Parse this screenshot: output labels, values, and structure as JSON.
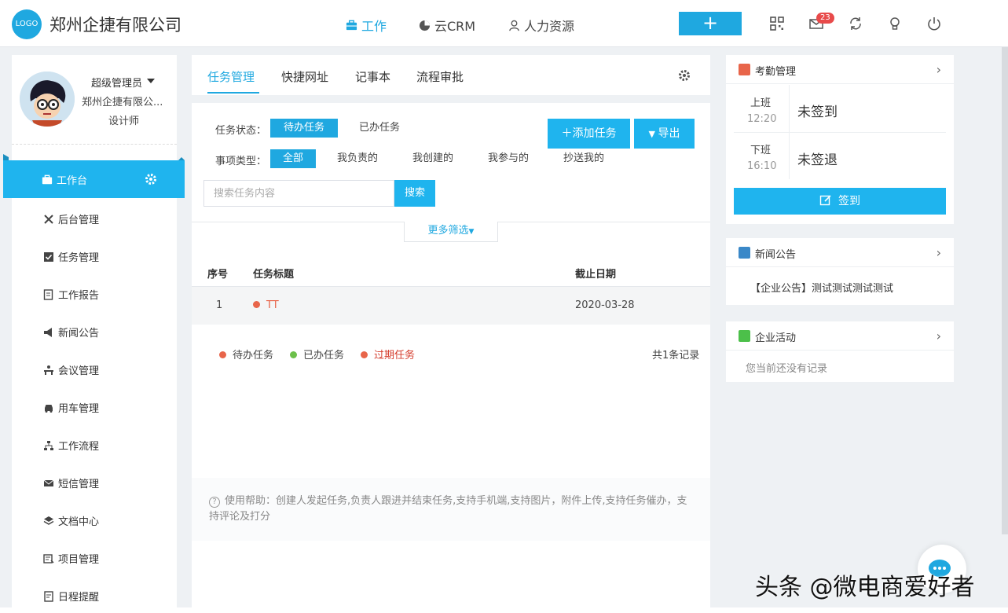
{
  "header": {
    "logo_text": "LOGO",
    "company": "郑州企捷有限公司",
    "nav": [
      {
        "label": "工作",
        "icon": "briefcase-icon",
        "active": true
      },
      {
        "label": "云CRM",
        "icon": "pie-chart-icon",
        "active": false
      },
      {
        "label": "人力资源",
        "icon": "user-icon",
        "active": false
      }
    ],
    "add_label": "+",
    "message_count": "23",
    "accent": "#1fa8e0"
  },
  "sidebar": {
    "role": "超级管理员",
    "company": "郑州企捷有限公...",
    "title": "设计师",
    "items": [
      {
        "label": "工作台",
        "icon": "briefcase-icon"
      },
      {
        "label": "后台管理",
        "icon": "tools-icon"
      },
      {
        "label": "任务管理",
        "icon": "checkbox-icon"
      },
      {
        "label": "工作报告",
        "icon": "report-icon"
      },
      {
        "label": "新闻公告",
        "icon": "megaphone-icon"
      },
      {
        "label": "会议管理",
        "icon": "meeting-icon"
      },
      {
        "label": "用车管理",
        "icon": "car-icon"
      },
      {
        "label": "工作流程",
        "icon": "flow-icon"
      },
      {
        "label": "短信管理",
        "icon": "mail-icon"
      },
      {
        "label": "文档中心",
        "icon": "layers-icon"
      },
      {
        "label": "项目管理",
        "icon": "project-icon"
      },
      {
        "label": "日程提醒",
        "icon": "calendar-icon"
      }
    ]
  },
  "main": {
    "tabs": [
      "任务管理",
      "快捷网址",
      "记事本",
      "流程审批"
    ],
    "status_label": "任务状态：",
    "status_options": [
      "待办任务",
      "已办任务"
    ],
    "type_label": "事项类型：",
    "type_options": [
      "全部",
      "我负责的",
      "我创建的",
      "我参与的",
      "抄送我的"
    ],
    "add_task": "添加任务",
    "export": "导出",
    "search_placeholder": "搜索任务内容",
    "search_btn": "搜索",
    "more_filter": "更多筛选",
    "columns": [
      "序号",
      "任务标题",
      "截止日期"
    ],
    "rows": [
      {
        "no": "1",
        "title": "TT",
        "deadline": "2020-03-28",
        "status_color": "#e8654a"
      }
    ],
    "legend": [
      {
        "label": "待办任务",
        "color": "#e8654a"
      },
      {
        "label": "已办任务",
        "color": "#6cc04a"
      },
      {
        "label": "过期任务",
        "color": "#e8654a"
      }
    ],
    "record_count": "共1条记录",
    "help": "使用帮助：创建人发起任务,负责人跟进并结束任务,支持手机端,支持图片，附件上传,支持任务催办，支持评论及打分"
  },
  "right": {
    "attendance": {
      "title": "考勤管理",
      "on_label": "上班",
      "on_time": "12:20",
      "on_status": "未签到",
      "off_label": "下班",
      "off_time": "16:10",
      "off_status": "未签退",
      "sign_btn": "签到"
    },
    "news": {
      "title": "新闻公告",
      "item": "【企业公告】测试测试测试测试"
    },
    "activity": {
      "title": "企业活动",
      "empty": "您当前还没有记录"
    }
  },
  "watermark": "头条 @微电商爱好者"
}
